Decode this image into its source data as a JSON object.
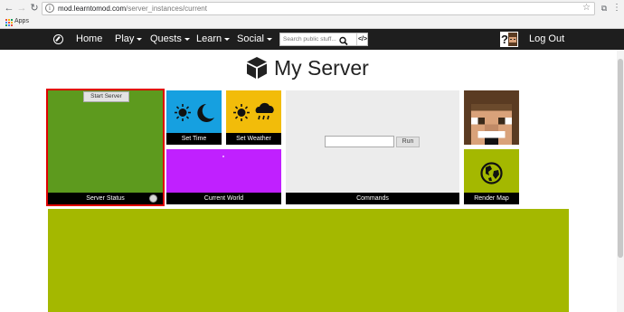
{
  "browser": {
    "url_host": "mod.learntomod.com",
    "url_path": "/server_instances/current",
    "bookmarks": {
      "apps_label": "Apps"
    }
  },
  "nav": {
    "home": "Home",
    "play": "Play",
    "quests": "Quests",
    "learn": "Learn",
    "social": "Social",
    "search_placeholder": "Search public stuff...",
    "code_glyph": "</>",
    "logout": "Log Out"
  },
  "page": {
    "title": "My Server"
  },
  "tiles": {
    "server_status": {
      "label": "Server Status",
      "start_button": "Start Server"
    },
    "set_time": {
      "label": "Set Time"
    },
    "set_weather": {
      "label": "Set Weather"
    },
    "current_world": {
      "label": "Current World"
    },
    "commands": {
      "label": "Commands",
      "run_button": "Run",
      "input_value": ""
    },
    "render_map": {
      "label": "Render Map"
    }
  },
  "colors": {
    "nav_bg": "#1e1e1e",
    "server_status": "#5d9a1e",
    "server_status_border": "#e00000",
    "set_time": "#16a0e0",
    "set_weather": "#f2bc0a",
    "current_world": "#c020ff",
    "commands": "#ececec",
    "render_map": "#a4b800",
    "main_panel": "#a4b800"
  },
  "icons": {
    "nav_logo": "compass-icon",
    "search": "search-icon",
    "site_logo": "cube-icon",
    "time_day": "sun-icon",
    "time_night": "moon-icon",
    "weather_clear": "sun-icon",
    "weather_rain": "rain-cloud-icon",
    "render_map": "globe-icon"
  }
}
